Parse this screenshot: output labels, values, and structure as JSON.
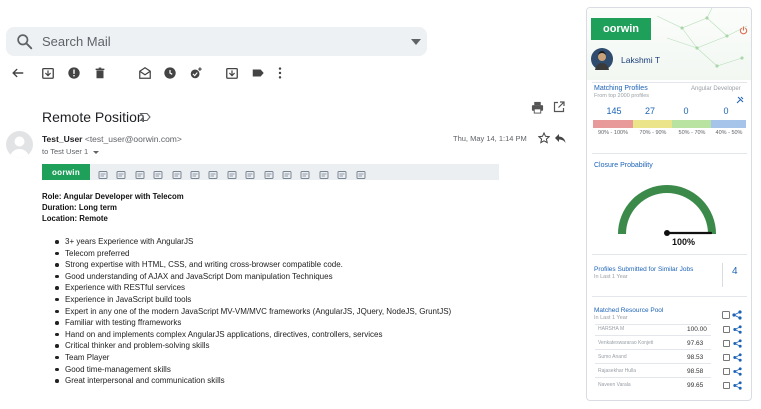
{
  "search": {
    "placeholder": "Search Mail"
  },
  "message": {
    "subject": "Remote Position",
    "sender_name": "Test_User",
    "sender_email": "<test_user@oorwin.com>",
    "to": "to Test User 1",
    "date": "Thu, May 14, 1:14 PM",
    "role_lines": [
      "Role: Angular Developer with Telecom",
      "Duration: Long term",
      "Location: Remote"
    ],
    "bullets": [
      "3+ years Experience with AngularJS",
      "Telecom preferred",
      "Strong expertise with HTML, CSS, and writing cross-browser compatible code.",
      "Good understanding of AJAX and JavaScript Dom manipulation Techniques",
      "Experience with RESTful services",
      "Experience in JavaScript build tools",
      "Expert in any one of the modern JavaScript MV-VM/MVC frameworks (AngularJS, JQuery, NodeJS, GruntJS)",
      "Familiar with testing fframeworks",
      "Hand on and implements complex AngularJS applications, directives, controllers, services",
      "Critical thinker and problem-solving skills",
      "Team Player",
      "Good time-management skills",
      "Great interpersonal and communication skills"
    ]
  },
  "addon": {
    "logo_text": "oorwin"
  },
  "panel": {
    "logo_text": "oorwin",
    "user_name": "Lakshmi T",
    "matching": {
      "title": "Matching Profiles",
      "subtitle": "From top 2000 profiles",
      "job": "Angular Developer",
      "counts": [
        "145",
        "27",
        "0",
        "0"
      ],
      "ranges": [
        "90% - 100%",
        "70% - 90%",
        "50% - 70%",
        "40% - 50%"
      ],
      "colors": [
        "#e89a9a",
        "#ece48a",
        "#b8e3a0",
        "#a6c3ea"
      ]
    },
    "closure": {
      "title": "Closure Probability",
      "value": "100%",
      "fraction": 1.0
    },
    "submitted": {
      "title": "Profiles Submitted for Similar Jobs",
      "subtitle": "In Last 1 Year",
      "count": "4"
    },
    "pool": {
      "title": "Matched Resource Pool",
      "subtitle": "In Last 1 Year",
      "rows": [
        {
          "name": "HARSHA M",
          "score": "100.00"
        },
        {
          "name": "Venkateswararao Konjeti",
          "score": "97.63"
        },
        {
          "name": "Sumo Anand",
          "score": "98.53"
        },
        {
          "name": "Rajasekhar Hulla",
          "score": "98.58"
        },
        {
          "name": "Naveen Varala",
          "score": "99.65"
        }
      ]
    }
  }
}
